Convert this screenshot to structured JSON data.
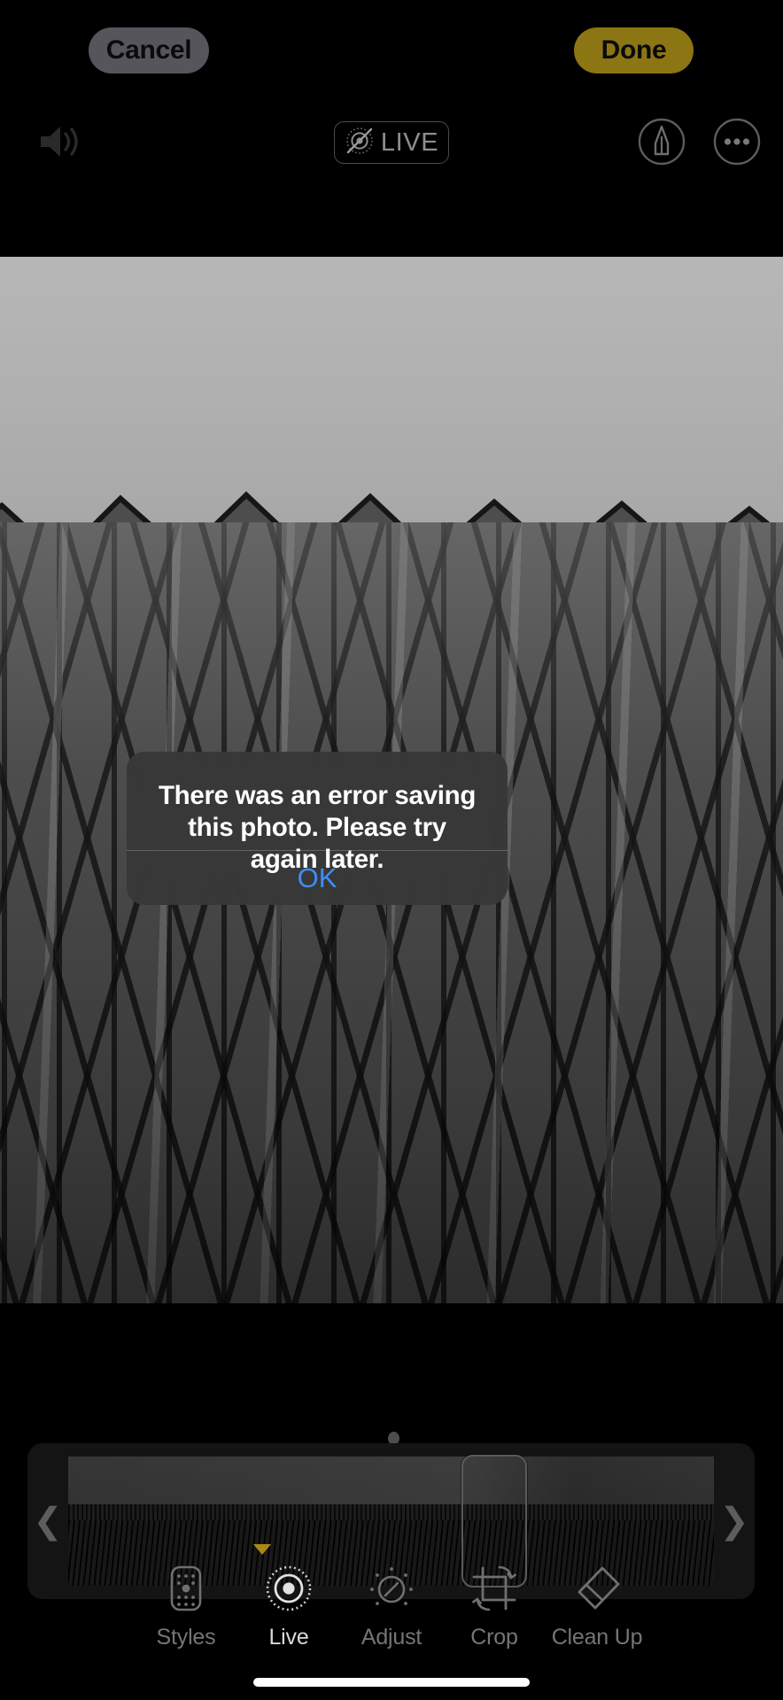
{
  "app": {
    "name": "Photos Editor",
    "screen": "live-photo-edit"
  },
  "colors": {
    "done_button_bg": "#8c7513",
    "cancel_button_bg": "#55555b",
    "alert_bg": "#383838",
    "ok_blue": "#3e8ef7",
    "active_tool_indicator": "#a98a17",
    "toolbar_inactive": "#757575",
    "toolbar_active": "#d9d9d9"
  },
  "topbar": {
    "cancel_label": "Cancel",
    "done_label": "Done",
    "speaker_icon": "speaker-wave-icon",
    "live_badge": {
      "label": "LIVE",
      "icon": "live-photo-off-icon",
      "state": "off"
    },
    "markup_icon": "markup-pen-icon",
    "more_icon": "more-ellipsis-icon"
  },
  "photo": {
    "description": "black and white photograph of a glass building facade with sawtooth roofline"
  },
  "alert": {
    "message": "There was an error saving this photo. Please try again later.",
    "ok_label": "OK"
  },
  "scrubber": {
    "left_chevron": "❮",
    "right_chevron": "❯",
    "keyframe_handle": "key-photo-selector",
    "position_dot": "playhead-dot"
  },
  "toolbar": {
    "items": [
      {
        "label": "Styles",
        "icon": "styles-icon",
        "active": false
      },
      {
        "label": "Live",
        "icon": "live-icon",
        "active": true
      },
      {
        "label": "Adjust",
        "icon": "adjust-icon",
        "active": false
      },
      {
        "label": "Crop",
        "icon": "crop-icon",
        "active": false
      },
      {
        "label": "Clean Up",
        "icon": "clean-up-icon",
        "active": false
      }
    ]
  },
  "system": {
    "home_indicator": "home-indicator"
  }
}
